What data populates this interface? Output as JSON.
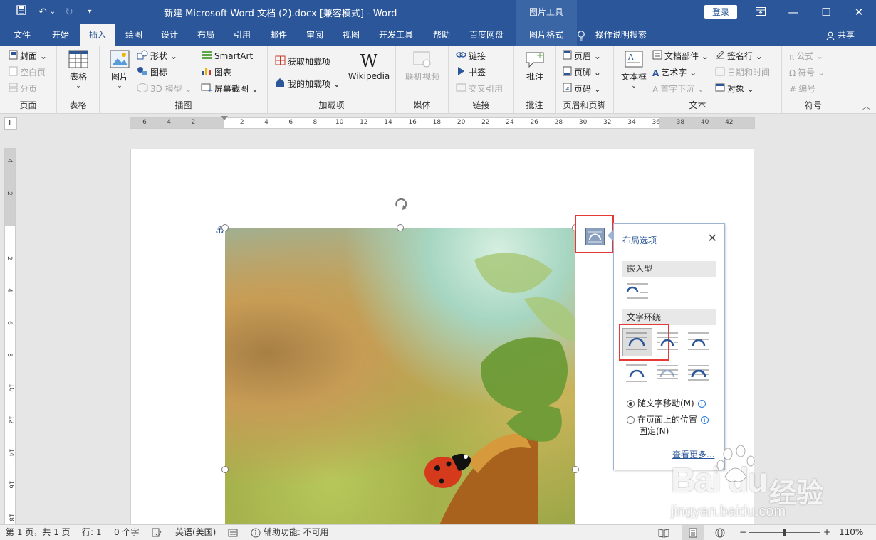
{
  "titlebar": {
    "title": "新建 Microsoft Word 文档 (2).docx [兼容模式]  -  Word",
    "context_tools": "图片工具",
    "login": "登录",
    "qa_undo_arrow": "⌄",
    "qa_customize": "▾"
  },
  "tabs": [
    "文件",
    "开始",
    "插入",
    "绘图",
    "设计",
    "布局",
    "引用",
    "邮件",
    "审阅",
    "视图",
    "开发工具",
    "帮助",
    "百度网盘",
    "图片格式"
  ],
  "active_tab": "插入",
  "tell_me": "操作说明搜索",
  "share": "共享",
  "ribbon": {
    "pages": {
      "label": "页面",
      "cover": "封面",
      "blank_page": "空白页",
      "page_break": "分页"
    },
    "tables": {
      "label": "表格",
      "table": "表格"
    },
    "illustrations": {
      "label": "插图",
      "pictures": "图片",
      "shapes": "形状",
      "icons": "图标",
      "model3d": "3D 模型",
      "smartart": "SmartArt",
      "chart": "图表",
      "screenshot": "屏幕截图"
    },
    "addins": {
      "label": "加载项",
      "get": "获取加载项",
      "my": "我的加载项",
      "wikipedia": "Wikipedia"
    },
    "media": {
      "label": "媒体",
      "online_video": "联机视频"
    },
    "links": {
      "label": "链接",
      "link": "链接",
      "bookmark": "书签",
      "cross_ref": "交叉引用"
    },
    "comments": {
      "label": "批注",
      "comment": "批注"
    },
    "header_footer": {
      "label": "页眉和页脚",
      "header": "页眉",
      "footer": "页脚",
      "page_number": "页码"
    },
    "text": {
      "label": "文本",
      "textbox": "文本框",
      "quick_parts": "文档部件",
      "wordart": "艺术字",
      "dropcap": "首字下沉",
      "signature": "签名行",
      "datetime": "日期和时间",
      "object": "对象"
    },
    "symbols": {
      "label": "符号",
      "equation": "公式",
      "symbol": "符号",
      "number": "编号"
    }
  },
  "ruler": {
    "h_ticks": [
      "6",
      "4",
      "2",
      "",
      "2",
      "4",
      "6",
      "8",
      "10",
      "12",
      "14",
      "16",
      "18",
      "20",
      "22",
      "24",
      "26",
      "28",
      "30",
      "32",
      "34",
      "36",
      "38",
      "40",
      "42"
    ],
    "v_ticks": [
      "4",
      "2",
      "",
      "2",
      "4",
      "6",
      "8",
      "10",
      "12",
      "14",
      "16",
      "18"
    ]
  },
  "layout_panel": {
    "title": "布局选项",
    "inline_header": "嵌入型",
    "wrap_header": "文字环绕",
    "move_with_text": "随文字移动(M)",
    "fix_position_line1": "在页面上的位置",
    "fix_position_line2": "固定(N)",
    "see_more": "查看更多...",
    "move_with_text_selected": true
  },
  "statusbar": {
    "page": "第 1 页，共 1 页",
    "words": "行: 1",
    "chars": "0 个字",
    "language": "英语(美国)",
    "accessibility": "辅助功能: 不可用",
    "zoom": "110%",
    "zoom_minus": "−",
    "zoom_plus": "+"
  },
  "watermark": {
    "logo": "Bai du",
    "cn": "经验",
    "url": "jingyan.baidu.com"
  },
  "colors": {
    "word_blue": "#2b579a",
    "highlight_red": "#e53935"
  }
}
